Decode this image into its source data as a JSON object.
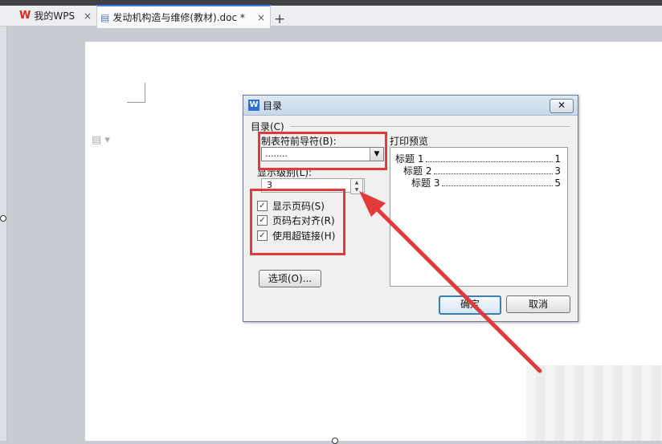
{
  "tabs": {
    "home_label": "我的WPS",
    "doc_label": "发动机构造与维修(教材).doc *",
    "close_glyph": "×",
    "new_tab_glyph": "+"
  },
  "dialog": {
    "title": "目录",
    "close_glyph": "✕",
    "group_label": "目录(C)",
    "leader_label": "制表符前导符(B):",
    "leader_value": "........",
    "level_label": "显示级别(L):",
    "level_value": "3",
    "checkboxes": [
      {
        "label": "显示页码(S)",
        "checked": true
      },
      {
        "label": "页码右对齐(R)",
        "checked": true
      },
      {
        "label": "使用超链接(H)",
        "checked": true
      }
    ],
    "check_glyph": "✓",
    "options_button": "选项(O)...",
    "preview_label": "打印预览",
    "preview_items": [
      {
        "text": "标题 1",
        "page": "1"
      },
      {
        "text": "标题 2",
        "page": "3"
      },
      {
        "text": "标题 3",
        "page": "5"
      }
    ],
    "ok_button": "确定",
    "cancel_button": "取消"
  },
  "colors": {
    "annotation_red": "#e23a3a",
    "wps_red": "#e4231b"
  }
}
